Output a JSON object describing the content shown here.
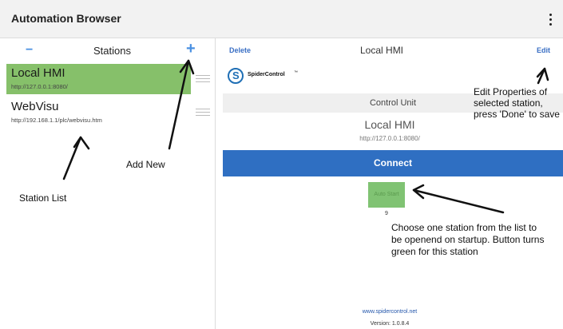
{
  "app": {
    "title": "Automation Browser"
  },
  "left": {
    "minus": "−",
    "title": "Stations",
    "plus": "+",
    "stations": [
      {
        "name": "Local HMI",
        "url": "http://127.0.0.1:8080/",
        "selected": true
      },
      {
        "name": "WebVisu",
        "url": "http://192.168.1.1/plc/webvisu.htm",
        "selected": false
      }
    ]
  },
  "right": {
    "delete_label": "Delete",
    "title": "Local HMI",
    "edit_label": "Edit",
    "logo_text": "SpiderControl",
    "logo_tm": "™",
    "control_unit": "Control Unit",
    "station_name": "Local HMI",
    "station_url": "http://127.0.0.1:8080/",
    "connect_label": "Connect",
    "autostart_label": "Auto Start",
    "autostart_number": "9",
    "footer_link": "www.spidercontrol.net",
    "footer_version": "Version: 1.0.8.4"
  },
  "annotations": {
    "add_new": "Add New",
    "station_list": "Station List",
    "edit_note_1": "Edit Properties of",
    "edit_note_2": "selected station,",
    "edit_note_3": "press 'Done' to save",
    "startup_note_1": "Choose one station from the list to",
    "startup_note_2": "be openend on startup. Button turns",
    "startup_note_3": "green for this station"
  },
  "colors": {
    "accent": "#2f6fc2",
    "selected_station": "#86c06a",
    "autostart": "#80c373"
  }
}
